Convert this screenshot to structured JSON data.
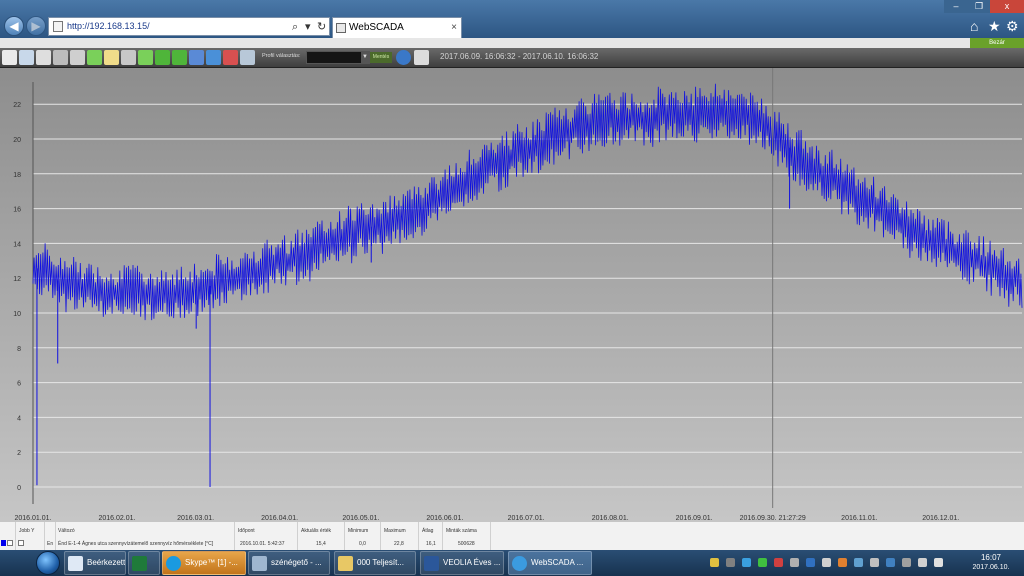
{
  "browser": {
    "url": "http://192.168.13.15/",
    "tab_title": "WebSCADA",
    "tab_close": "×",
    "window_min": "–",
    "window_max": "❐",
    "window_close": "x"
  },
  "app": {
    "close_button": "Bezár",
    "profile_label": "Profil választás:",
    "save_label": "Mentés",
    "date_range": "2017.06.09. 16:06:32 - 2017.06.10. 16:06:32"
  },
  "chart_data": {
    "type": "line",
    "y_ticks": [
      "0",
      "2",
      "4",
      "6",
      "8",
      "10",
      "12",
      "14",
      "16",
      "18",
      "20",
      "22"
    ],
    "ylim": [
      0,
      22.8
    ],
    "x_ticks": [
      {
        "label": "2016.01.01.",
        "t": 0.0
      },
      {
        "label": "2016.02.01.",
        "t": 0.0849
      },
      {
        "label": "2016.03.01.",
        "t": 0.1644
      },
      {
        "label": "2016.04.01.",
        "t": 0.2493
      },
      {
        "label": "2016.05.01.",
        "t": 0.3315
      },
      {
        "label": "2016.06.01.",
        "t": 0.4164
      },
      {
        "label": "2016.07.01.",
        "t": 0.4986
      },
      {
        "label": "2016.08.01.",
        "t": 0.5836
      },
      {
        "label": "2016.09.01.",
        "t": 0.6685
      },
      {
        "label": "2016.11.01.",
        "t": 0.8356
      },
      {
        "label": "2016.12.01.",
        "t": 0.9178
      }
    ],
    "cursor_label": "2016.09.30. 21:27:29",
    "cursor_t": 0.7479,
    "series": [
      {
        "color": "#1010e0",
        "mean": [
          [
            0.0,
            12.7
          ],
          [
            0.03,
            11.7
          ],
          [
            0.08,
            11.2
          ],
          [
            0.14,
            11.1
          ],
          [
            0.17,
            11.4
          ],
          [
            0.22,
            12.3
          ],
          [
            0.27,
            13.3
          ],
          [
            0.32,
            14.6
          ],
          [
            0.37,
            15.4
          ],
          [
            0.42,
            17.0
          ],
          [
            0.47,
            18.6
          ],
          [
            0.52,
            20.0
          ],
          [
            0.57,
            21.1
          ],
          [
            0.62,
            21.2
          ],
          [
            0.66,
            21.5
          ],
          [
            0.7,
            21.6
          ],
          [
            0.72,
            21.4
          ],
          [
            0.75,
            20.4
          ],
          [
            0.78,
            18.6
          ],
          [
            0.82,
            17.3
          ],
          [
            0.86,
            15.8
          ],
          [
            0.9,
            14.4
          ],
          [
            0.95,
            13.1
          ],
          [
            1.0,
            11.8
          ]
        ],
        "spikes": [
          {
            "t": 0.004,
            "v": 0.1
          },
          {
            "t": 0.025,
            "v": 7.1
          },
          {
            "t": 0.165,
            "v": 9.1
          },
          {
            "t": 0.179,
            "v": 0.0
          },
          {
            "t": 0.342,
            "v": 12.9
          },
          {
            "t": 0.765,
            "v": 16.0
          }
        ]
      }
    ]
  },
  "table": {
    "headers": {
      "jobb_y": "Jobb Y",
      "valtozo": "Változó",
      "idopont": "Időpont",
      "aktualis": "Aktuális érték",
      "minimum": "Minimum",
      "maximum": "Maximum",
      "atlag": "Átlag",
      "mintak": "Minták száma"
    },
    "row": {
      "en": "En",
      "valtozo": "Énd E-1-4 Ágnes utca szennyvízátemelő szennyvíz hőmérséklete [°C]",
      "idopont": "2016.10.01. 5:42:37",
      "aktualis": "15,4",
      "minimum": "0,0",
      "maximum": "22,8",
      "atlag": "16,1",
      "mintak": "500628"
    }
  },
  "taskbar": {
    "items": [
      {
        "label": "Beérkezett ü..."
      },
      {
        "label": ""
      },
      {
        "label": "Skype™ [1] -..."
      },
      {
        "label": "szénégető - ..."
      },
      {
        "label": "000 Teljesít..."
      },
      {
        "label": "VEOLIA Éves ..."
      },
      {
        "label": "WebSCADA ..."
      }
    ],
    "time": "16:07",
    "date": "2017.06.10."
  }
}
